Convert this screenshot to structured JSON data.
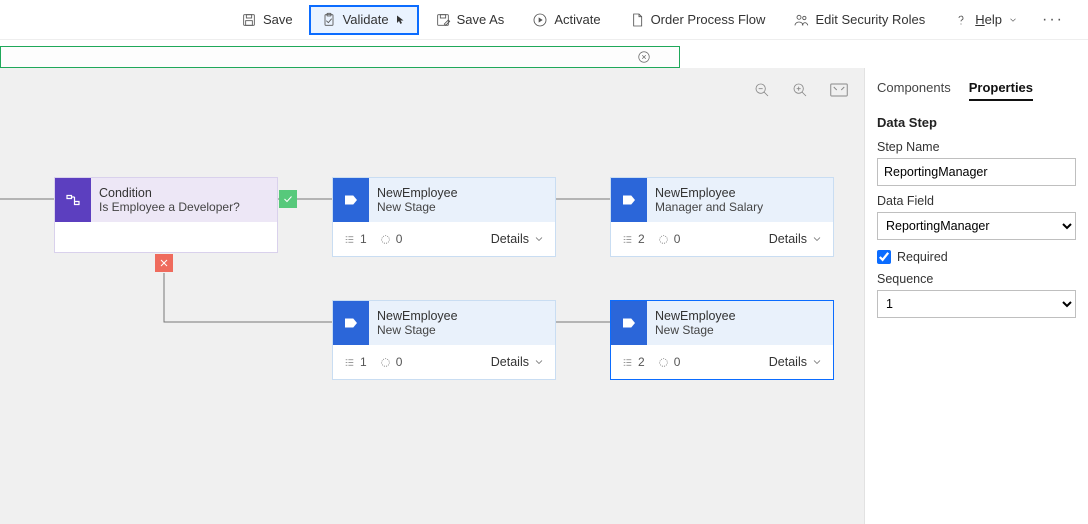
{
  "toolbar": {
    "save": "Save",
    "validate": "Validate",
    "save_as": "Save As",
    "activate": "Activate",
    "order": "Order Process Flow",
    "roles": "Edit Security Roles",
    "help": "Help"
  },
  "canvas": {
    "condition": {
      "title": "Condition",
      "subtitle": "Is Employee a Developer?"
    },
    "stage_a": {
      "title": "NewEmployee",
      "subtitle": "New Stage",
      "steps": "1",
      "details": "Details"
    },
    "stage_b": {
      "title": "NewEmployee",
      "subtitle": "Manager and Salary",
      "steps": "2",
      "details": "Details"
    },
    "stage_c": {
      "title": "NewEmployee",
      "subtitle": "New Stage",
      "steps": "1",
      "details": "Details"
    },
    "stage_d": {
      "title": "NewEmployee",
      "subtitle": "New Stage",
      "steps": "2",
      "details": "Details"
    },
    "branch": "0"
  },
  "panel": {
    "tab_components": "Components",
    "tab_properties": "Properties",
    "section": "Data Step",
    "step_name_label": "Step Name",
    "step_name_value": "ReportingManager",
    "data_field_label": "Data Field",
    "data_field_value": "ReportingManager",
    "required_label": "Required",
    "sequence_label": "Sequence",
    "sequence_value": "1"
  }
}
